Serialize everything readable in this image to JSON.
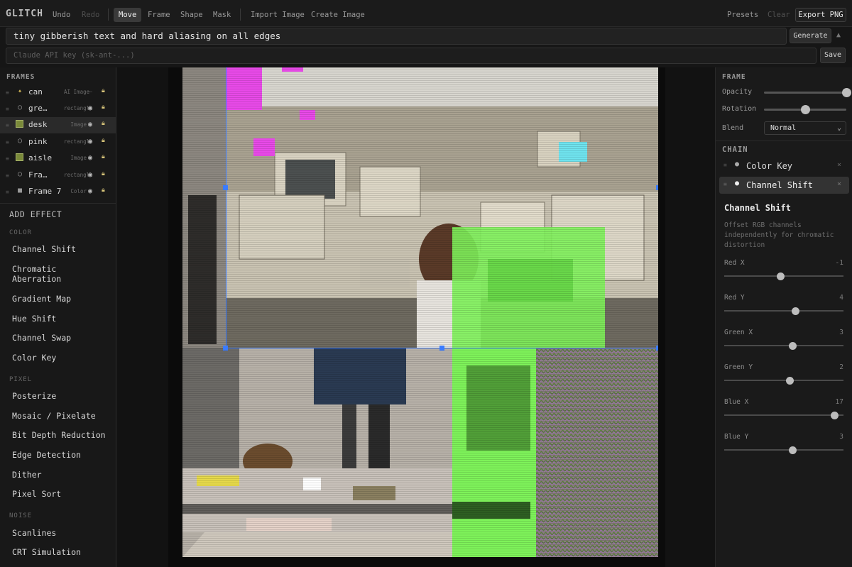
{
  "brand": "GLITCH",
  "toolbar": {
    "undo": "Undo",
    "redo": "Redo",
    "move": "Move",
    "frame": "Frame",
    "shape": "Shape",
    "mask": "Mask",
    "import_image": "Import Image",
    "create_image": "Create Image",
    "presets": "Presets",
    "clear": "Clear",
    "export": "Export PNG"
  },
  "prompt": {
    "value": "tiny gibberish text and hard aliasing on all edges",
    "generate": "Generate"
  },
  "api": {
    "placeholder": "Claude API key (sk-ant-...)",
    "save": "Save"
  },
  "frames": {
    "title": "FRAMES",
    "items": [
      {
        "name": "can",
        "type": "AI Image",
        "icon": "sparkle-icon"
      },
      {
        "name": "gre…",
        "type": "rectangle",
        "icon": "circle-icon"
      },
      {
        "name": "desk",
        "type": "Image",
        "icon": "image-icon"
      },
      {
        "name": "pink",
        "type": "rectangle",
        "icon": "circle-icon"
      },
      {
        "name": "aisle",
        "type": "Image",
        "icon": "image-icon"
      },
      {
        "name": "Fra…",
        "type": "rectangle",
        "icon": "circle-icon"
      },
      {
        "name": "Frame 7",
        "type": "Color",
        "icon": "square-icon"
      }
    ]
  },
  "effects": {
    "title": "ADD EFFECT",
    "color_label": "COLOR",
    "color": [
      "Channel Shift",
      "Chromatic Aberration",
      "Gradient Map",
      "Hue Shift",
      "Channel Swap",
      "Color Key"
    ],
    "pixel_label": "PIXEL",
    "pixel": [
      "Posterize",
      "Mosaic / Pixelate",
      "Bit Depth Reduction",
      "Edge Detection",
      "Dither",
      "Pixel Sort"
    ],
    "noise_label": "NOISE",
    "noise": [
      "Scanlines",
      "CRT Simulation"
    ]
  },
  "frame_panel": {
    "title": "FRAME",
    "opacity": "Opacity",
    "opacity_value": 1.0,
    "rotation": "Rotation",
    "rotation_value": 0.5,
    "blend": "Blend",
    "blend_value": "Normal"
  },
  "chain": {
    "title": "CHAIN",
    "items": [
      "Color Key",
      "Channel Shift"
    ]
  },
  "effect_detail": {
    "title": "Channel Shift",
    "description": "Offset RGB channels independently for chromatic distortion",
    "params": [
      {
        "label": "Red X",
        "value": "-1",
        "min": -20,
        "max": 20
      },
      {
        "label": "Red Y",
        "value": "4",
        "min": -20,
        "max": 20
      },
      {
        "label": "Green X",
        "value": "3",
        "min": -20,
        "max": 20
      },
      {
        "label": "Green Y",
        "value": "2",
        "min": -20,
        "max": 20
      },
      {
        "label": "Blue X",
        "value": "17",
        "min": -20,
        "max": 20
      },
      {
        "label": "Blue Y",
        "value": "3",
        "min": -20,
        "max": 20
      }
    ]
  },
  "colors": {
    "accent_green": "#7ef25a",
    "accent_magenta": "#e84ae8",
    "selection_blue": "#3a7bff"
  }
}
